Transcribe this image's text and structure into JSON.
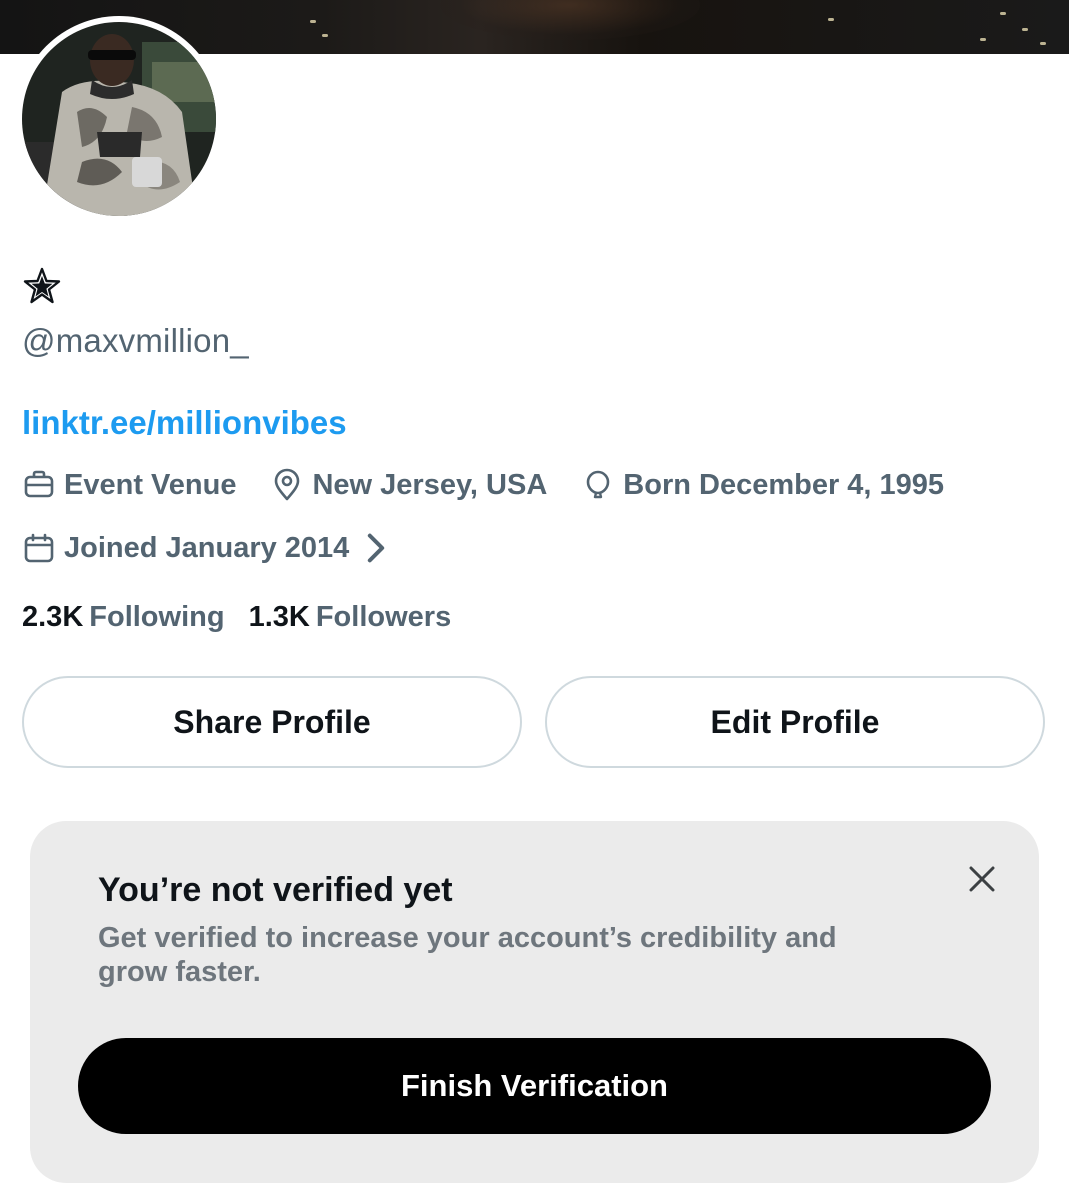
{
  "profile": {
    "display_name_icon": "star-icon",
    "handle": "@maxvmillion_",
    "link": "linktr.ee/millionvibes",
    "category": "Event Venue",
    "location": "New Jersey, USA",
    "birthday": "Born December 4, 1995",
    "joined": "Joined January 2014"
  },
  "stats": {
    "following_count": "2.3K",
    "following_label": "Following",
    "followers_count": "1.3K",
    "followers_label": "Followers"
  },
  "actions": {
    "share_label": "Share Profile",
    "edit_label": "Edit Profile"
  },
  "verification": {
    "title": "You’re not verified yet",
    "description": "Get verified to increase your account’s credibility and grow faster.",
    "button_label": "Finish Verification"
  },
  "colors": {
    "link": "#1d9bf0",
    "secondary_text": "#536471",
    "card_background": "#ebebeb",
    "primary_button": "#000000"
  }
}
